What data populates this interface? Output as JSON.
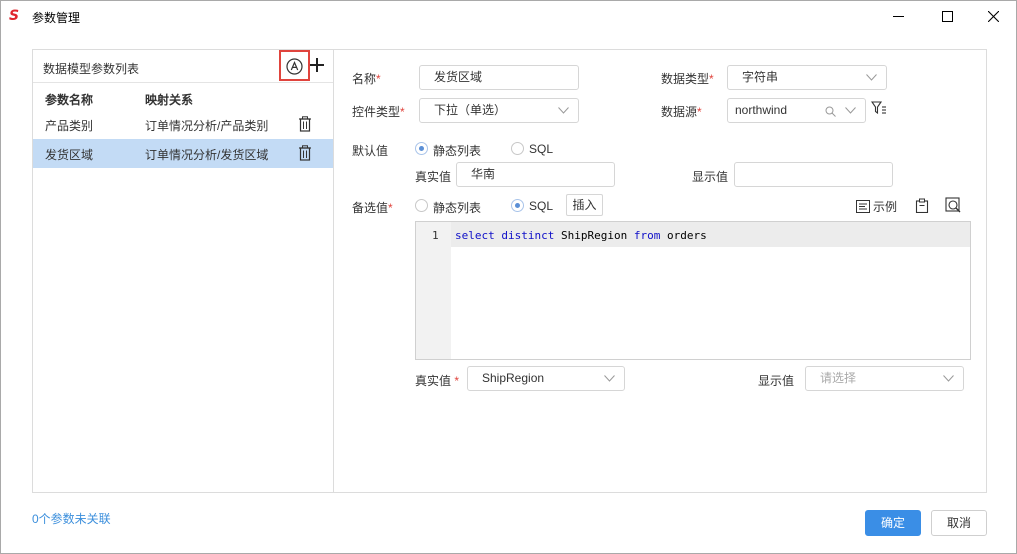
{
  "window": {
    "title": "参数管理",
    "logo": "S",
    "controls": [
      "minimize-icon",
      "maximize-icon",
      "close-icon"
    ]
  },
  "left_panel": {
    "title": "数据模型参数列表",
    "columns": [
      "参数名称",
      "映射关系"
    ],
    "rows": [
      {
        "name": "产品类别",
        "mapping": "订单情况分析/产品类别",
        "selected": false
      },
      {
        "name": "发货区域",
        "mapping": "订单情况分析/发货区域",
        "selected": true
      }
    ],
    "icons": [
      "circle-a-icon",
      "plus-icon",
      "trash-icon"
    ]
  },
  "form": {
    "name_label": "名称",
    "name_value": "发货区域",
    "data_type_label": "数据类型",
    "data_type_value": "字符串",
    "control_type_label": "控件类型",
    "control_type_value": "下拉（单选）",
    "data_source_label": "数据源",
    "data_source_value": "northwind",
    "default_label": "默认值",
    "default_options": [
      "静态列表",
      "SQL"
    ],
    "default_selected": "静态列表",
    "default_real_label": "真实值",
    "default_real_value": "华南",
    "default_display_label": "显示值",
    "default_display_value": "",
    "candidate_label": "备选值",
    "candidate_options": [
      "静态列表",
      "SQL"
    ],
    "candidate_selected": "SQL",
    "insert_button": "插入",
    "example_button": "示例",
    "editor": {
      "line_number": "1",
      "kw1": "select",
      "kw2": "distinct",
      "field": "ShipRegion",
      "kw3": "from",
      "table": "orders"
    },
    "candidate_real_label": "真实值",
    "candidate_real_value": "ShipRegion",
    "candidate_display_label": "显示值",
    "candidate_display_placeholder": "请选择",
    "required_mark": "*"
  },
  "footer": {
    "unlinked_text": "0个参数未关联",
    "ok_button": "确定",
    "cancel_button": "取消"
  },
  "colors": {
    "accent": "#3a8ee6",
    "selected_row": "#c3dbf5",
    "required": "#e0443d",
    "highlight_box": "#e0443d",
    "sql_keyword": "#1010c8"
  }
}
